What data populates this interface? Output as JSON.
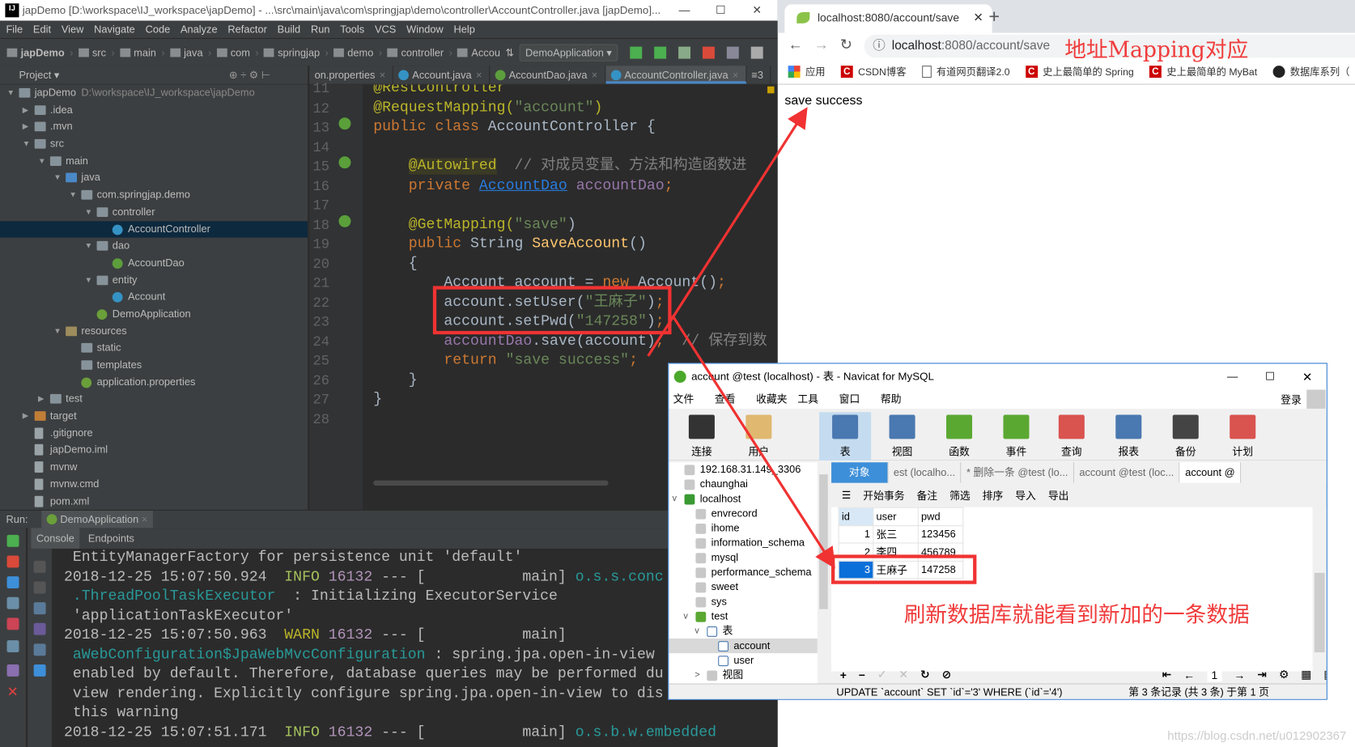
{
  "ide": {
    "title": "japDemo [D:\\workspace\\IJ_workspace\\japDemo] - ...\\src\\main\\java\\com\\springjap\\demo\\controller\\AccountController.java [japDemo]...",
    "menu": [
      "File",
      "Edit",
      "View",
      "Navigate",
      "Code",
      "Analyze",
      "Refactor",
      "Build",
      "Run",
      "Tools",
      "VCS",
      "Window",
      "Help"
    ],
    "breadcrumbs": [
      "japDemo",
      "src",
      "main",
      "java",
      "com",
      "springjap",
      "demo",
      "controller",
      "Accou"
    ],
    "run_config": "DemoApplication",
    "project_label": "Project",
    "tree": [
      {
        "level": 0,
        "arrow": "▼",
        "icon": "folder",
        "label": "japDemo",
        "hint": "D:\\workspace\\IJ_workspace\\japDemo"
      },
      {
        "level": 1,
        "arrow": "▶",
        "icon": "folder",
        "label": ".idea"
      },
      {
        "level": 1,
        "arrow": "▶",
        "icon": "folder",
        "label": ".mvn"
      },
      {
        "level": 1,
        "arrow": "▼",
        "icon": "folder",
        "label": "src"
      },
      {
        "level": 2,
        "arrow": "▼",
        "icon": "folder",
        "label": "main"
      },
      {
        "level": 3,
        "arrow": "▼",
        "icon": "src",
        "label": "java"
      },
      {
        "level": 4,
        "arrow": "▼",
        "icon": "pkg",
        "label": "com.springjap.demo"
      },
      {
        "level": 5,
        "arrow": "▼",
        "icon": "pkg",
        "label": "controller"
      },
      {
        "level": 6,
        "arrow": "",
        "icon": "cls",
        "label": "AccountController",
        "selected": true
      },
      {
        "level": 5,
        "arrow": "▼",
        "icon": "pkg",
        "label": "dao"
      },
      {
        "level": 6,
        "arrow": "",
        "icon": "intf",
        "label": "AccountDao"
      },
      {
        "level": 5,
        "arrow": "▼",
        "icon": "pkg",
        "label": "entity"
      },
      {
        "level": 6,
        "arrow": "",
        "icon": "cls",
        "label": "Account"
      },
      {
        "level": 5,
        "arrow": "",
        "icon": "spring",
        "label": "DemoApplication"
      },
      {
        "level": 3,
        "arrow": "▼",
        "icon": "res",
        "label": "resources"
      },
      {
        "level": 4,
        "arrow": "",
        "icon": "folder",
        "label": "static"
      },
      {
        "level": 4,
        "arrow": "",
        "icon": "folder",
        "label": "templates"
      },
      {
        "level": 4,
        "arrow": "",
        "icon": "spring",
        "label": "application.properties"
      },
      {
        "level": 2,
        "arrow": "▶",
        "icon": "folder",
        "label": "test"
      },
      {
        "level": 1,
        "arrow": "▶",
        "icon": "target",
        "label": "target"
      },
      {
        "level": 1,
        "arrow": "",
        "icon": "file",
        "label": ".gitignore"
      },
      {
        "level": 1,
        "arrow": "",
        "icon": "file",
        "label": "japDemo.iml"
      },
      {
        "level": 1,
        "arrow": "",
        "icon": "file",
        "label": "mvnw"
      },
      {
        "level": 1,
        "arrow": "",
        "icon": "file",
        "label": "mvnw.cmd"
      },
      {
        "level": 1,
        "arrow": "",
        "icon": "file",
        "label": "pom.xml"
      }
    ],
    "tabs": [
      {
        "label": "on.properties",
        "icon": "",
        "active": false
      },
      {
        "label": "Account.java",
        "icon": "#3592c4",
        "active": false
      },
      {
        "label": "AccountDao.java",
        "icon": "#5c9f3c",
        "active": false
      },
      {
        "label": "AccountController.java",
        "icon": "#3592c4",
        "active": true
      }
    ],
    "tabs_more": "≡3",
    "code": [
      {
        "n": "11",
        "t": [
          [
            "@RestController",
            "t-an"
          ]
        ]
      },
      {
        "n": "12",
        "t": [
          [
            "@RequestMapping(",
            "t-an"
          ],
          [
            "\"account\"",
            "t-str"
          ],
          [
            ")",
            "t-an"
          ]
        ]
      },
      {
        "n": "13",
        "t": [
          [
            "public class ",
            "t-kw"
          ],
          [
            "AccountController {",
            "t-pl"
          ]
        ]
      },
      {
        "n": "14",
        "t": []
      },
      {
        "n": "15",
        "t": [
          [
            "    ",
            ""
          ],
          [
            "@Autowired",
            "t-anbg"
          ],
          [
            "  // 对成员变量、方法和构造函数进",
            "t-cm"
          ]
        ]
      },
      {
        "n": "16",
        "t": [
          [
            "    private ",
            "t-kw"
          ],
          [
            "AccountDao",
            "t-ty"
          ],
          [
            " accountDao",
            "t-fld"
          ],
          [
            ";",
            "t-kw"
          ]
        ]
      },
      {
        "n": "17",
        "t": []
      },
      {
        "n": "18",
        "t": [
          [
            "    @GetMapping(",
            "t-an"
          ],
          [
            "\"save\"",
            "t-str"
          ],
          [
            ")",
            "t-pl"
          ]
        ]
      },
      {
        "n": "19",
        "t": [
          [
            "    public ",
            "t-kw"
          ],
          [
            "String ",
            "t-pl"
          ],
          [
            "SaveAccount",
            "t-fn"
          ],
          [
            "()",
            "t-pl"
          ]
        ]
      },
      {
        "n": "20",
        "t": [
          [
            "    {",
            "t-pl"
          ]
        ]
      },
      {
        "n": "21",
        "t": [
          [
            "        Account account = ",
            "t-pl"
          ],
          [
            "new ",
            "t-kw"
          ],
          [
            "Account()",
            "t-pl"
          ],
          [
            ";",
            "t-kw"
          ]
        ]
      },
      {
        "n": "22",
        "t": [
          [
            "        account.setUser(",
            "t-pl"
          ],
          [
            "\"王麻子\"",
            "t-str"
          ],
          [
            ")",
            "t-pl"
          ],
          [
            ";",
            "t-kw"
          ]
        ]
      },
      {
        "n": "23",
        "t": [
          [
            "        account.setPwd(",
            "t-pl"
          ],
          [
            "\"147258\"",
            "t-str"
          ],
          [
            ")",
            "t-pl"
          ],
          [
            ";",
            "t-kw"
          ]
        ]
      },
      {
        "n": "24",
        "t": [
          [
            "        ",
            ""
          ],
          [
            "accountDao",
            "t-fld"
          ],
          [
            ".save(account)",
            "t-pl"
          ],
          [
            ";",
            "t-kw"
          ],
          [
            "  // 保存到数",
            "t-cm"
          ]
        ]
      },
      {
        "n": "25",
        "t": [
          [
            "        return ",
            "t-kw"
          ],
          [
            "\"save success\"",
            "t-str"
          ],
          [
            ";",
            "t-kw"
          ]
        ]
      },
      {
        "n": "26",
        "t": [
          [
            "    }",
            "t-pl"
          ]
        ]
      },
      {
        "n": "27",
        "t": [
          [
            "}",
            "t-pl"
          ]
        ]
      },
      {
        "n": "28",
        "t": []
      }
    ],
    "run": {
      "label": "Run:",
      "config": "DemoApplication",
      "tabs": [
        "Console",
        "Endpoints"
      ]
    },
    "console": [
      [
        [
          " EntityManagerFactory for persistence unit 'default'",
          "c-pl"
        ]
      ],
      [
        [
          "2018-12-25 15:07:50.924  ",
          "c-pl"
        ],
        [
          "INFO ",
          "c-info"
        ],
        [
          "16132",
          "c-pid"
        ],
        [
          " --- [           main] ",
          "c-pl"
        ],
        [
          "o.s.s.conc",
          "c-cls"
        ]
      ],
      [
        [
          " .ThreadPoolTaskExecutor",
          "c-cls"
        ],
        [
          "  : Initializing ExecutorService",
          "c-pl"
        ]
      ],
      [
        [
          " 'applicationTaskExecutor'",
          "c-pl"
        ]
      ],
      [
        [
          "2018-12-25 15:07:50.963  ",
          "c-pl"
        ],
        [
          "WARN ",
          "c-warn"
        ],
        [
          "16132",
          "c-pid"
        ],
        [
          " --- [           main]",
          "c-pl"
        ]
      ],
      [
        [
          " aWebConfiguration$JpaWebMvcConfiguration",
          "c-cls"
        ],
        [
          " : spring.jpa.open-in-view",
          "c-pl"
        ]
      ],
      [
        [
          " enabled by default. Therefore, database queries may be performed du",
          "c-pl"
        ]
      ],
      [
        [
          " view rendering. Explicitly configure spring.jpa.open-in-view to dis",
          "c-pl"
        ]
      ],
      [
        [
          " this warning",
          "c-pl"
        ]
      ],
      [
        [
          "2018-12-25 15:07:51.171  ",
          "c-pl"
        ],
        [
          "INFO ",
          "c-info"
        ],
        [
          "16132",
          "c-pid"
        ],
        [
          " --- [           main] ",
          "c-pl"
        ],
        [
          "o.s.b.w.embedded",
          "c-cls"
        ]
      ]
    ]
  },
  "browser": {
    "tab_title": "localhost:8080/account/save",
    "url_host": "localhost",
    "url_rest": ":8080/account/save",
    "bookmarks": [
      {
        "icon": "apps-icon",
        "label": "应用"
      },
      {
        "icon": "csdn-icon",
        "label": "CSDN博客"
      },
      {
        "icon": "page-icon",
        "label": "有道网页翻译2.0"
      },
      {
        "icon": "csdn-icon",
        "label": "史上最简单的 Spring"
      },
      {
        "icon": "csdn-icon",
        "label": "史上最简单的 MyBat"
      },
      {
        "icon": "github-icon",
        "label": "数据库系列（"
      }
    ],
    "body_text": "save success"
  },
  "navicat": {
    "title": "account @test (localhost) - 表 - Navicat for MySQL",
    "menu": [
      "文件",
      "查看",
      "收藏夹",
      "工具",
      "窗口",
      "帮助"
    ],
    "login": "登录",
    "tools": [
      {
        "label": "连接",
        "color": "#333"
      },
      {
        "label": "用户",
        "color": "#e0b870"
      },
      {
        "label": "表",
        "color": "#4a78b0",
        "active": true
      },
      {
        "label": "视图",
        "color": "#4a78b0"
      },
      {
        "label": "函数",
        "color": "#5aa832"
      },
      {
        "label": "事件",
        "color": "#5aa832"
      },
      {
        "label": "查询",
        "color": "#d9534f"
      },
      {
        "label": "报表",
        "color": "#4a78b0"
      },
      {
        "label": "备份",
        "color": "#444"
      },
      {
        "label": "计划",
        "color": "#d9534f"
      }
    ],
    "tree": [
      {
        "level": 0,
        "arrow": "",
        "icon": "conn",
        "label": "192.168.31.149_3306"
      },
      {
        "level": 0,
        "arrow": "",
        "icon": "conn",
        "label": "chaunghai"
      },
      {
        "level": 0,
        "arrow": "v",
        "icon": "conn-on",
        "label": "localhost"
      },
      {
        "level": 1,
        "arrow": "",
        "icon": "db",
        "label": "envrecord"
      },
      {
        "level": 1,
        "arrow": "",
        "icon": "db",
        "label": "ihome"
      },
      {
        "level": 1,
        "arrow": "",
        "icon": "db",
        "label": "information_schema"
      },
      {
        "level": 1,
        "arrow": "",
        "icon": "db",
        "label": "mysql"
      },
      {
        "level": 1,
        "arrow": "",
        "icon": "db",
        "label": "performance_schema"
      },
      {
        "level": 1,
        "arrow": "",
        "icon": "db",
        "label": "sweet"
      },
      {
        "level": 1,
        "arrow": "",
        "icon": "db",
        "label": "sys"
      },
      {
        "level": 1,
        "arrow": "v",
        "icon": "db-on",
        "label": "test"
      },
      {
        "level": 2,
        "arrow": "v",
        "icon": "tbl",
        "label": "表"
      },
      {
        "level": 3,
        "arrow": "",
        "icon": "tbl",
        "label": "account",
        "selected": true
      },
      {
        "level": 3,
        "arrow": "",
        "icon": "tbl",
        "label": "user"
      },
      {
        "level": 2,
        "arrow": ">",
        "icon": "view",
        "label": "视图"
      }
    ],
    "obj_tabs": [
      "对象",
      "est (localho...",
      "* 删除一条 @test (lo...",
      "account @test (loc...",
      "account @"
    ],
    "sub_tools": [
      "开始事务",
      "备注",
      "筛选",
      "排序",
      "导入",
      "导出"
    ],
    "columns": [
      "id",
      "user",
      "pwd"
    ],
    "rows": [
      [
        "1",
        "张三",
        "123456"
      ],
      [
        "2",
        "李四",
        "456789"
      ],
      [
        "3",
        "王麻子",
        "147258"
      ]
    ],
    "page": "1",
    "status_sql": "UPDATE `account` SET `id`='3' WHERE (`id`='4')",
    "status_records": "第 3 条记录 (共 3 条) 于第 1 页"
  },
  "annotations": {
    "mapping": "地址Mapping对应",
    "refresh": "刷新数据库就能看到新加的一条数据",
    "color": "#f03232"
  },
  "watermark": "https://blog.csdn.net/u012902367"
}
